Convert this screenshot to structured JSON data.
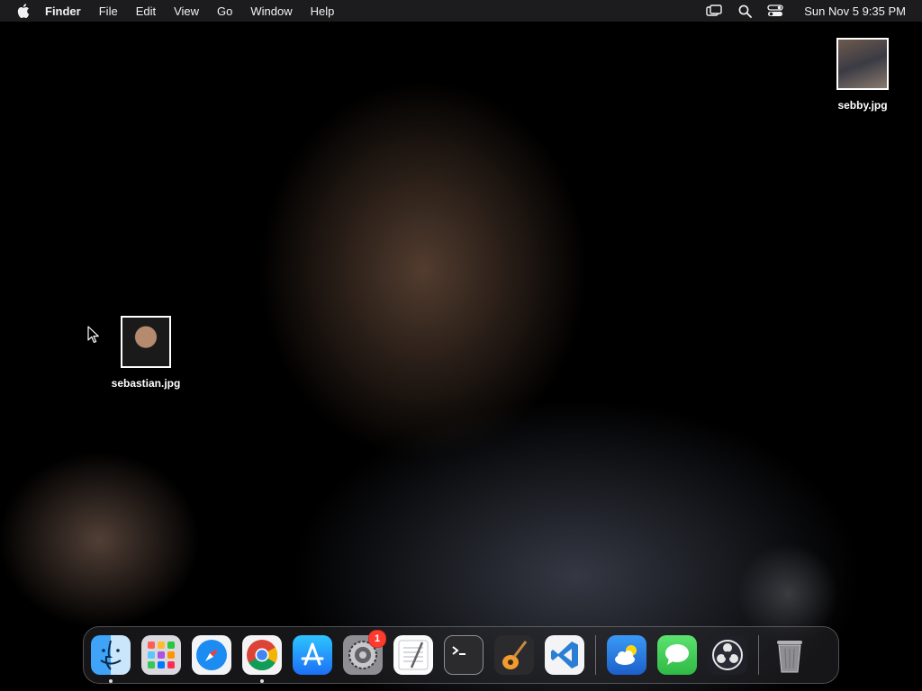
{
  "menubar": {
    "app_name": "Finder",
    "items": [
      "File",
      "Edit",
      "View",
      "Go",
      "Window",
      "Help"
    ],
    "clock": "Sun Nov 5  9:35 PM",
    "status_icons": [
      "screen-mirroring-icon",
      "spotlight-search-icon",
      "control-center-icon"
    ]
  },
  "desktop": {
    "files": [
      {
        "name": "sebby.jpg"
      },
      {
        "name": "sebastian.jpg"
      }
    ]
  },
  "dock": {
    "apps": [
      {
        "name": "Finder",
        "icon": "finder-icon",
        "running": true
      },
      {
        "name": "Launchpad",
        "icon": "launchpad-icon",
        "running": false
      },
      {
        "name": "Safari",
        "icon": "safari-icon",
        "running": false
      },
      {
        "name": "Google Chrome",
        "icon": "chrome-icon",
        "running": true
      },
      {
        "name": "App Store",
        "icon": "app-store-icon",
        "running": false
      },
      {
        "name": "System Settings",
        "icon": "system-settings-icon",
        "running": false,
        "badge": "1"
      },
      {
        "name": "TextEdit",
        "icon": "textedit-icon",
        "running": false
      },
      {
        "name": "Terminal",
        "icon": "terminal-icon",
        "running": false
      },
      {
        "name": "GarageBand",
        "icon": "garageband-icon",
        "running": false
      },
      {
        "name": "Visual Studio Code",
        "icon": "vscode-icon",
        "running": false
      },
      {
        "name": "Weather",
        "icon": "weather-icon",
        "running": false
      },
      {
        "name": "Messages",
        "icon": "messages-icon",
        "running": false
      },
      {
        "name": "OBS",
        "icon": "obs-icon",
        "running": false
      },
      {
        "name": "Trash",
        "icon": "trash-icon",
        "running": false
      }
    ],
    "colors": {
      "finder": "#2b8ef0",
      "safari": "#1d8cf2",
      "app_store": "#1c8df5",
      "vscode": "#2a7fd4",
      "messages": "#36c759",
      "badge": "#ff3b30"
    }
  }
}
